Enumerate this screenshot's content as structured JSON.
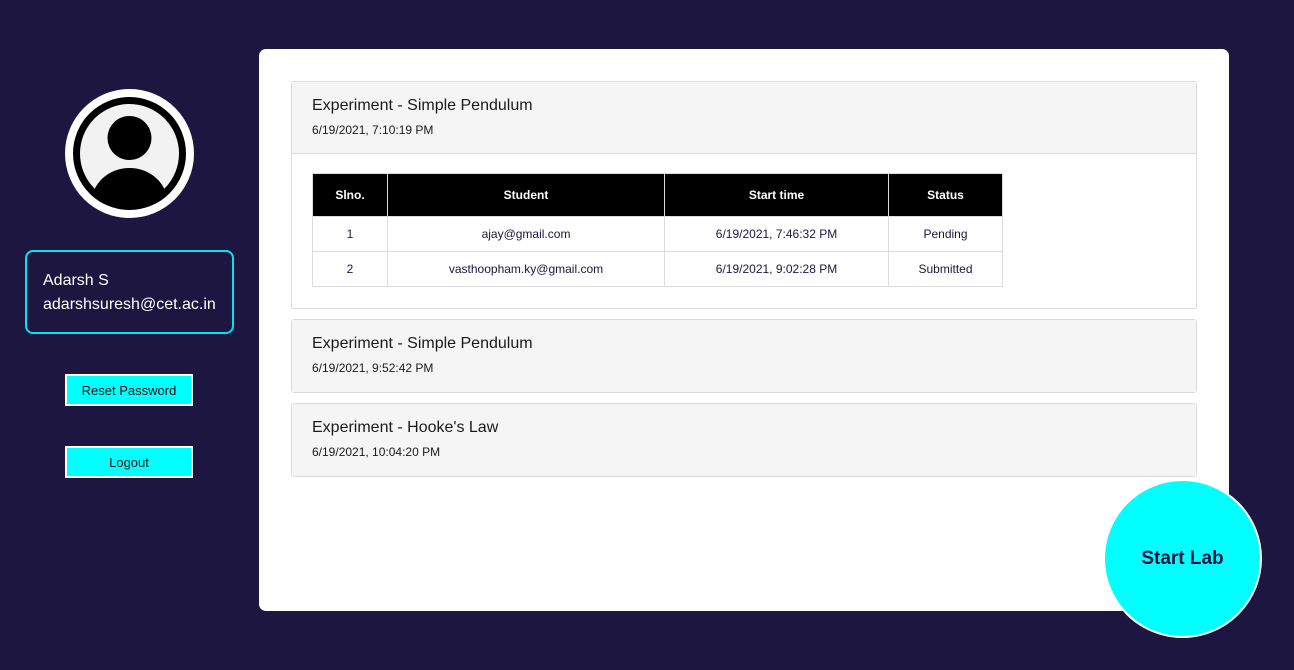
{
  "user": {
    "name": "Adarsh S",
    "email": "adarshsuresh@cet.ac.in"
  },
  "sidebar": {
    "reset_label": "Reset Password",
    "logout_label": "Logout"
  },
  "table_headers": [
    "Slno.",
    "Student",
    "Start time",
    "Status"
  ],
  "experiments": [
    {
      "title": "Experiment - Simple Pendulum",
      "date": "6/19/2021, 7:10:19 PM",
      "expanded": true,
      "rows": [
        {
          "slno": "1",
          "student": "ajay@gmail.com",
          "start_time": "6/19/2021, 7:46:32 PM",
          "status": "Pending"
        },
        {
          "slno": "2",
          "student": "vasthoopham.ky@gmail.com",
          "start_time": "6/19/2021, 9:02:28 PM",
          "status": "Submitted"
        }
      ]
    },
    {
      "title": "Experiment - Simple Pendulum",
      "date": "6/19/2021, 9:52:42 PM",
      "expanded": false
    },
    {
      "title": "Experiment - Hooke's Law",
      "date": "6/19/2021, 10:04:20 PM",
      "expanded": false
    }
  ],
  "start_lab_label": "Start Lab",
  "colors": {
    "background": "#1d1640",
    "accent": "#00ffff",
    "card_border": "#00e5f0",
    "table_header": "#000000"
  },
  "icons": {
    "avatar": "user-avatar-icon"
  }
}
